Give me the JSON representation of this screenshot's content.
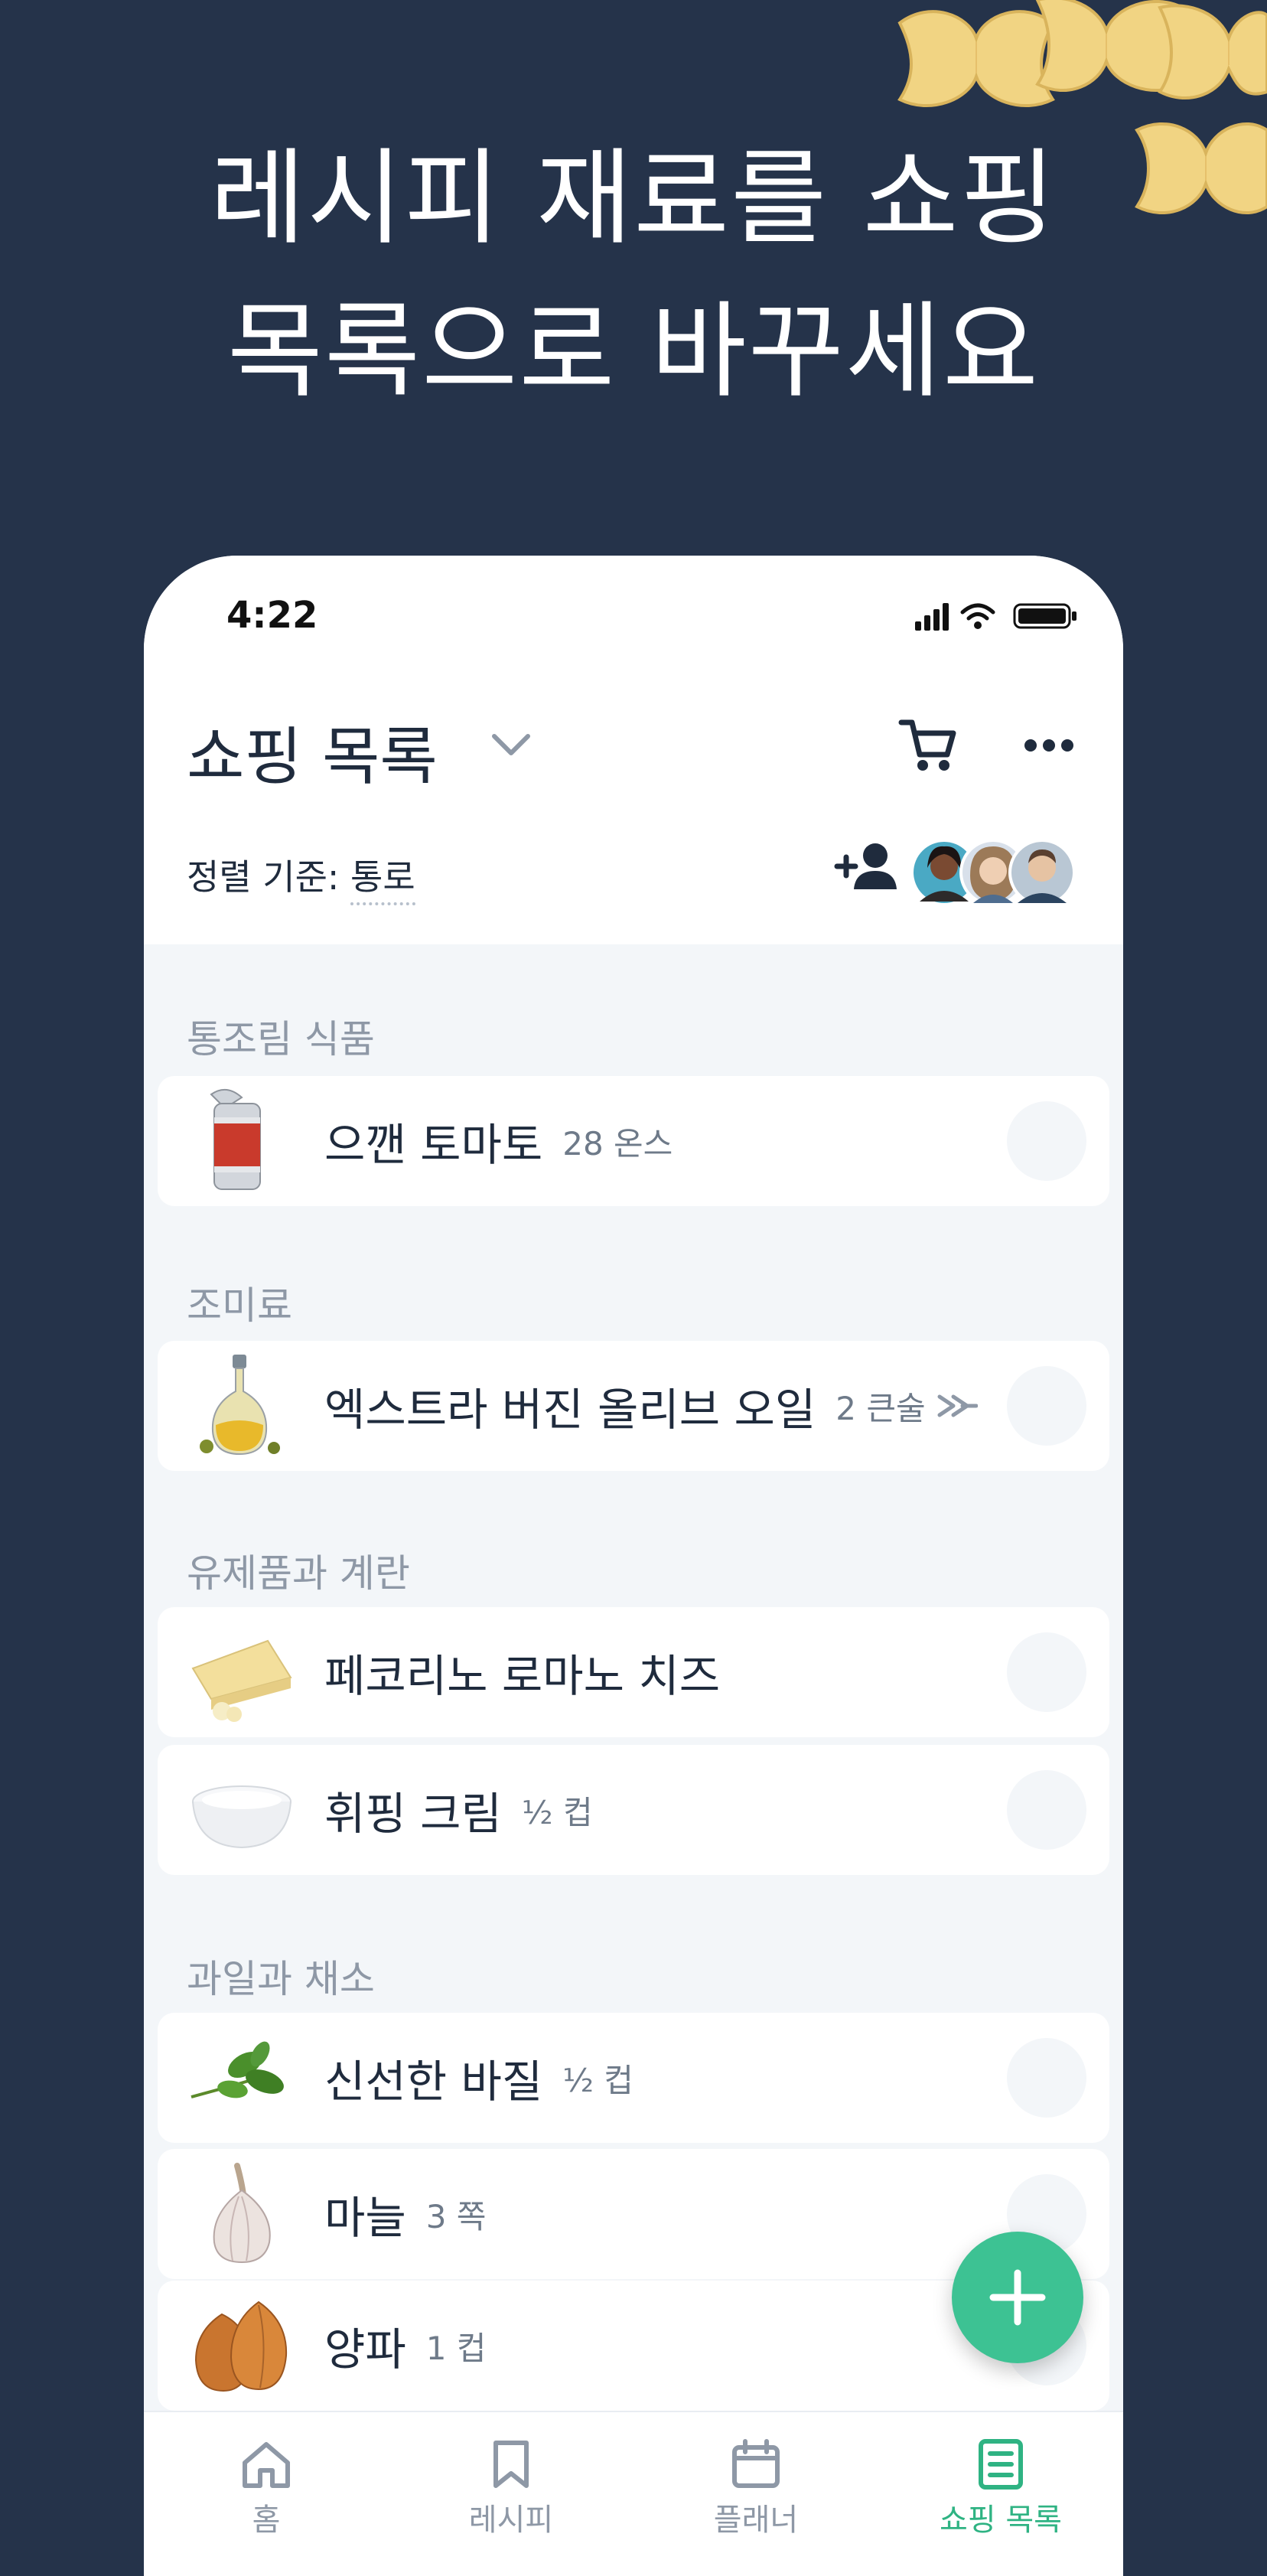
{
  "headline": {
    "line1": "레시피 재료를 쇼핑",
    "line2": "목록으로 바꾸세요"
  },
  "status_bar": {
    "time": "4:22"
  },
  "header": {
    "title": "쇼핑 목록",
    "sort_prefix": "정렬 기준: ",
    "sort_value": "통로"
  },
  "sections": [
    {
      "name": "통조림 식품",
      "items": [
        {
          "name": "으깬 토마토",
          "qty": "28 온스",
          "icon": "tomato-can-icon"
        }
      ]
    },
    {
      "name": "조미료",
      "items": [
        {
          "name": "엑스트라 버진 올리브 오일",
          "qty": "2 큰술",
          "icon": "olive-oil-icon"
        }
      ]
    },
    {
      "name": "유제품과 계란",
      "items": [
        {
          "name": "페코리노 로마노 치즈",
          "qty": "",
          "icon": "cheese-icon"
        },
        {
          "name": "휘핑 크림",
          "qty": "½ 컵",
          "icon": "cream-icon"
        }
      ]
    },
    {
      "name": "과일과 채소",
      "items": [
        {
          "name": "신선한 바질",
          "qty": "½ 컵",
          "icon": "basil-icon"
        },
        {
          "name": "마늘",
          "qty": "3 쪽",
          "icon": "garlic-icon"
        },
        {
          "name": "양파",
          "qty": "1 컵",
          "icon": "onion-icon"
        }
      ]
    }
  ],
  "tabs": [
    {
      "label": "홈",
      "icon": "home-icon"
    },
    {
      "label": "레시피",
      "icon": "bookmark-icon"
    },
    {
      "label": "플래너",
      "icon": "calendar-icon"
    },
    {
      "label": "쇼핑 목록",
      "icon": "list-icon"
    }
  ],
  "colors": {
    "background": "#25334a",
    "accent": "#3dc293",
    "active_tab": "#2fb383"
  }
}
